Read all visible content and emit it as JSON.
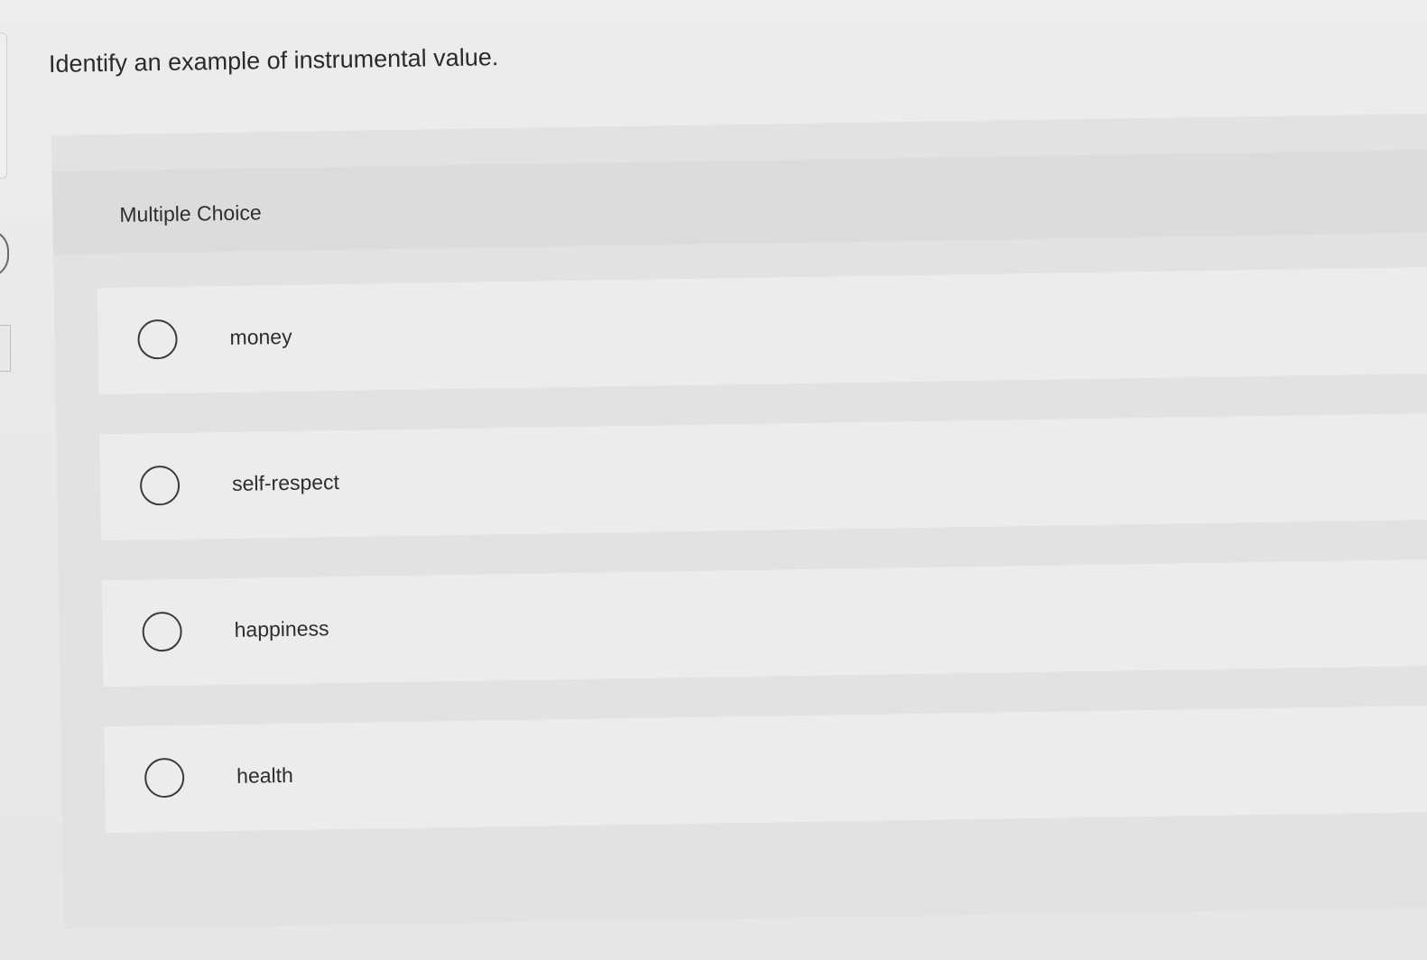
{
  "question": {
    "text": "Identify an example of instrumental value."
  },
  "multiple_choice": {
    "label": "Multiple Choice",
    "options": [
      {
        "label": "money"
      },
      {
        "label": "self-respect"
      },
      {
        "label": "happiness"
      },
      {
        "label": "health"
      }
    ]
  },
  "colors": {
    "background": "#eaeaea",
    "panel": "#e2e2e2",
    "option_background": "#ececec",
    "text": "#2b2b2b"
  }
}
